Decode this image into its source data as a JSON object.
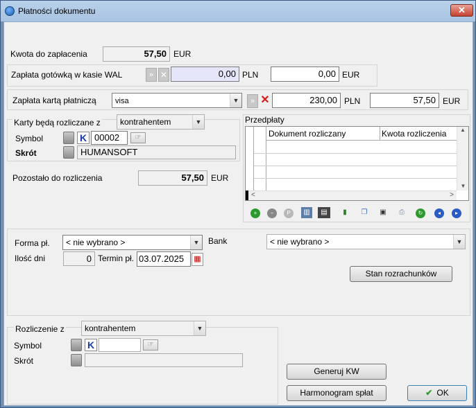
{
  "window": {
    "title": "Płatności dokumentu",
    "close": "✕"
  },
  "kwota": {
    "label": "Kwota do zapłacenia",
    "value": "57,50",
    "currency": "EUR"
  },
  "gotowka": {
    "label": "Zapłata gotówką w kasie WAL",
    "pln_value": "0,00",
    "pln_currency": "PLN",
    "eur_value": "0,00",
    "eur_currency": "EUR"
  },
  "karta": {
    "label": "Zapłata kartą płatniczą",
    "card": "visa",
    "pln_value": "230,00",
    "pln_currency": "PLN",
    "eur_value": "57,50",
    "eur_currency": "EUR"
  },
  "karty_rozliczane": {
    "label": "Karty będą rozliczane z",
    "option": "kontrahentem",
    "symbol_label": "Symbol",
    "symbol_value": "00002",
    "skrot_label": "Skrót",
    "skrot_value": "HUMANSOFT",
    "k": "K"
  },
  "pozostalo": {
    "label": "Pozostało do rozliczenia",
    "value": "57,50",
    "currency": "EUR"
  },
  "przedplaty": {
    "label": "Przedpłaty",
    "columns": [
      "Dokument rozliczany",
      "Kwota rozliczenia"
    ]
  },
  "forma": {
    "label": "Forma pł.",
    "value": "< nie wybrano >",
    "bank_label": "Bank",
    "bank_value": "< nie wybrano >",
    "ilosc_label": "Ilość dni",
    "ilosc_value": "0",
    "termin_label": "Termin pł.",
    "termin_value": "03.07.2025",
    "stan_button": "Stan rozrachunków"
  },
  "rozliczenie": {
    "label": "Rozliczenie z",
    "option": "kontrahentem",
    "symbol_label": "Symbol",
    "skrot_label": "Skrót",
    "k": "K"
  },
  "buttons": {
    "generuj": "Generuj KW",
    "harmonogram": "Harmonogram spłat",
    "ok": "OK"
  }
}
